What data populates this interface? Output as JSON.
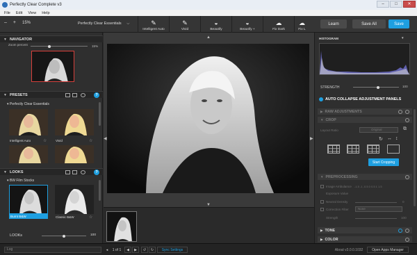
{
  "window": {
    "title": "Perfectly Clear Complete v3",
    "min": "–",
    "max": "□",
    "close": "✕"
  },
  "menu": [
    "File",
    "Edit",
    "View",
    "Help"
  ],
  "toolbar": {
    "zoom_minus": "–",
    "zoom_plus": "+",
    "zoom_value": "15%",
    "preset": "Perfectly Clear Essentials",
    "tools": [
      {
        "label": "Intelligent Auto",
        "icon": "hd-wand-icon",
        "glyph": "✎"
      },
      {
        "label": "Vivid",
        "icon": "brush-icon",
        "glyph": "✎"
      },
      {
        "label": "Beautify",
        "icon": "lips-icon",
        "glyph": "◒"
      },
      {
        "label": "Beautify +",
        "icon": "lips-plus-icon",
        "glyph": "◒"
      },
      {
        "label": "Fix Dark",
        "icon": "cloud-icon",
        "glyph": "☁"
      },
      {
        "label": "Fix L",
        "icon": "cloud-icon",
        "glyph": "☁"
      }
    ],
    "learn": "Learn",
    "save_all": "Save All",
    "save": "Save"
  },
  "left": {
    "navigator": {
      "title": "NAVIGATOR",
      "zoom_label": "Zoom percent",
      "zoom_value": "15%"
    },
    "presets": {
      "title": "PRESETS",
      "group": "Perfectly Clear Essentials",
      "items": [
        {
          "label": "Intelligent Auto"
        },
        {
          "label": "Vivid"
        },
        {
          "label": ""
        },
        {
          "label": ""
        }
      ]
    },
    "looks": {
      "title": "LOOKS",
      "group": "BW Film Stocks",
      "items": [
        {
          "label": "Burnt B&W"
        },
        {
          "label": "Classic B&W"
        }
      ],
      "slider_label": "LOOKs",
      "slider_value": "100"
    }
  },
  "right": {
    "histogram_title": "HISTOGRAM",
    "strength_label": "STRENGTH",
    "strength_value": "100",
    "auto_collapse": "AUTO COLLAPSE ADJUSTMENT PANELS",
    "raw_adjustments": "RAW ADJUSTMENTS",
    "crop": {
      "title": "CROP",
      "layout_ratio": "Layout Ratio",
      "ratio_value": "Original",
      "start_button": "Start Cropping"
    },
    "preprocessing": {
      "title": "PREPROCESSING",
      "image_ambulance": "Image Ambulance",
      "exposure_value": "Exposure Value",
      "ev_scale": "-1.5 -1 -0.5 0 0.5 1 1.5",
      "neutral_density": "Neutral Density",
      "nd_value": "0",
      "correction_filter": "Correction Filter",
      "filter_value": "None",
      "strength": "Strength",
      "strength_value": "100"
    },
    "tone": "TONE",
    "color": "COLOR"
  },
  "status": {
    "search_placeholder": "Log",
    "page": "1 of 1",
    "sync": "Sync Settings",
    "about": "About v3.0.0.1032",
    "manager": "Open Apps Manager"
  }
}
